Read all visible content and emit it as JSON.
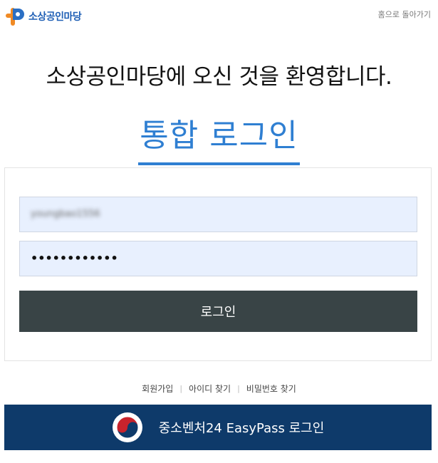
{
  "header": {
    "logo_text": "소상공인마당",
    "home_link": "홈으로 돌아가기"
  },
  "welcome": "소상공인마당에 오신 것을 환영합니다.",
  "title": "통합 로그인",
  "form": {
    "id_value": "youngbao1556",
    "password_masked": "••••••••••••",
    "login_button": "로그인"
  },
  "links": {
    "signup": "회원가입",
    "find_id": "아이디 찾기",
    "find_password": "비밀번호 찾기",
    "separator": "|"
  },
  "easypass": {
    "label": "중소벤처24 EasyPass 로그인"
  },
  "colors": {
    "accent_blue": "#2f7fd2",
    "button_dark": "#394446",
    "banner_navy": "#0e3a6a",
    "input_bg": "#e8f0fe",
    "logo_orange": "#f08a24"
  }
}
